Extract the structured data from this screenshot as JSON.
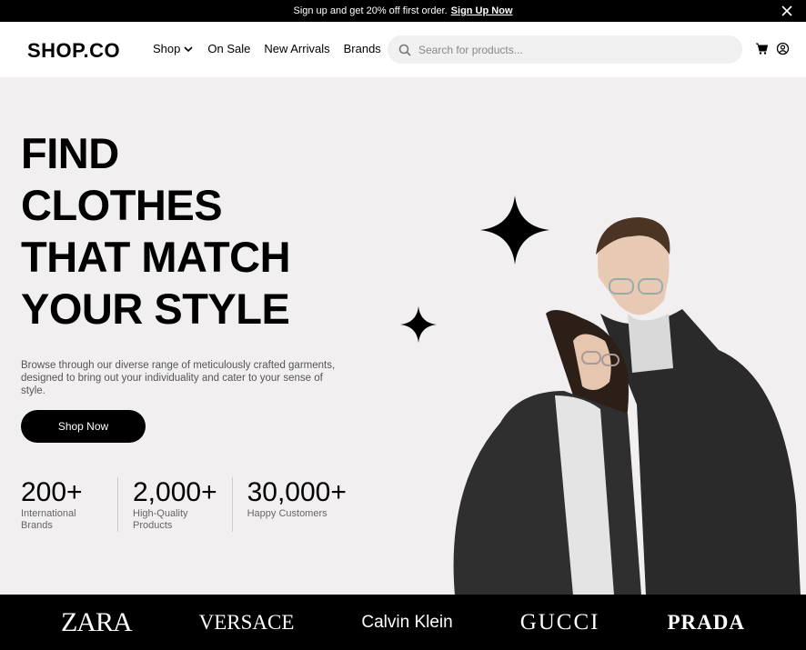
{
  "promo": {
    "text": "Sign up and get 20% off first order.",
    "link": "Sign Up Now"
  },
  "nav": {
    "logo": "SHOP.CO",
    "items": [
      "Shop",
      "On Sale",
      "New Arrivals",
      "Brands"
    ],
    "search_placeholder": "Search for products..."
  },
  "hero": {
    "headline": [
      "FIND",
      "CLOTHES",
      "THAT MATCH",
      "YOUR STYLE"
    ],
    "description": "Browse through our diverse range of meticulously crafted garments, designed to bring out your individuality and cater to your sense of style.",
    "cta": "Shop Now",
    "stats": [
      {
        "value": "200+",
        "label": "International Brands"
      },
      {
        "value": "2,000+",
        "label": "High-Quality Products"
      },
      {
        "value": "30,000+",
        "label": "Happy Customers"
      }
    ]
  },
  "brands": [
    "ZARA",
    "VERSACE",
    "Calvin Klein",
    "GUCCI",
    "PRADA"
  ]
}
